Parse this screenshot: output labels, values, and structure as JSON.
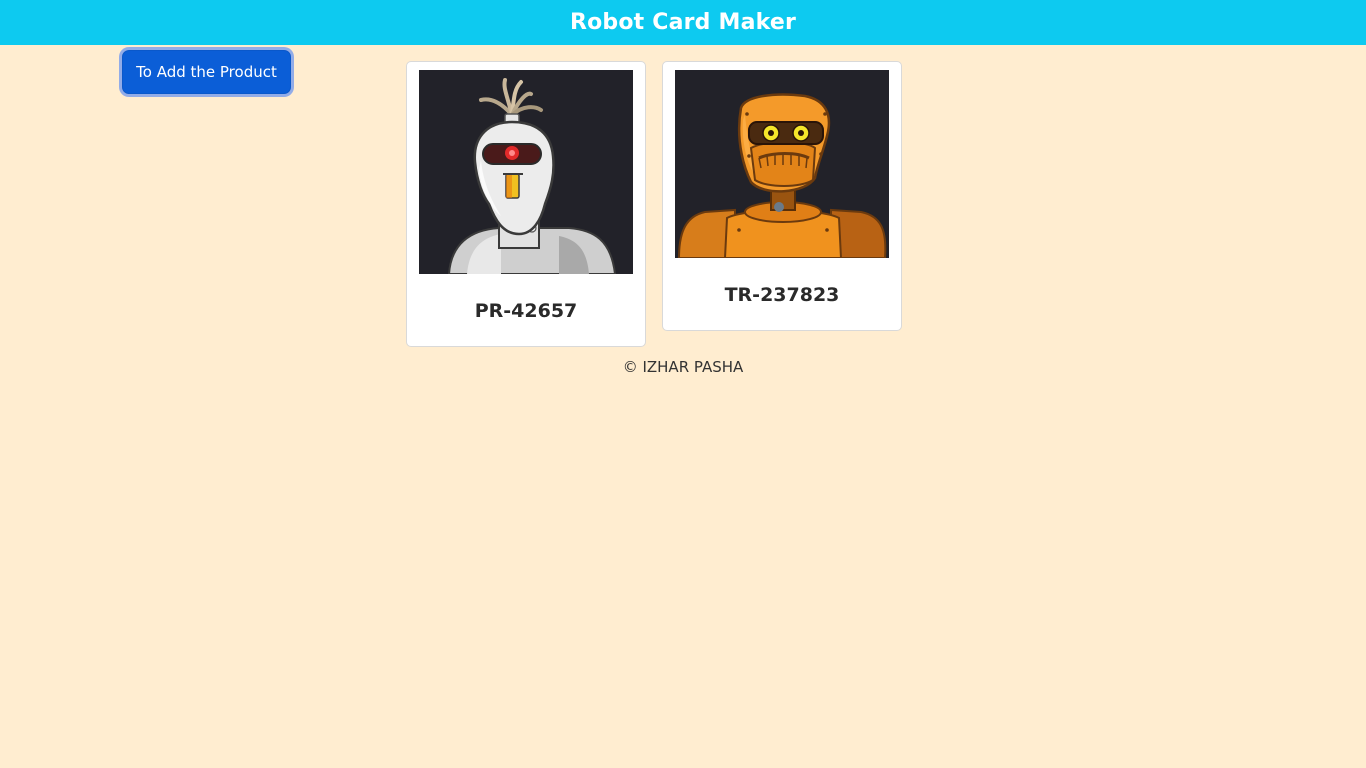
{
  "header": {
    "title": "Robot Card Maker"
  },
  "actions": {
    "add_product_label": "To Add the Product"
  },
  "cards": [
    {
      "title": "PR-42657",
      "image": "white-robot-avatar"
    },
    {
      "title": "TR-237823",
      "image": "orange-robot-avatar"
    }
  ],
  "footer": {
    "text": "© IZHAR PASHA"
  },
  "colors": {
    "header_bg": "#0dcaf0",
    "page_bg": "#ffedd0",
    "button_bg": "#0b5ed7",
    "card_bg": "#ffffff",
    "image_bg": "#222229"
  }
}
